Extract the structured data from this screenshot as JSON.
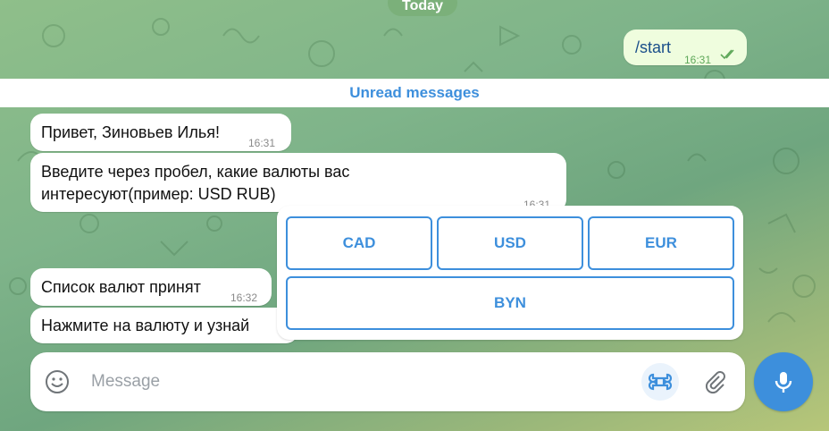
{
  "date_separator": "Today",
  "unread_label": "Unread messages",
  "outgoing": [
    {
      "text": "/start",
      "time": "16:31"
    }
  ],
  "incoming": [
    {
      "text": "Привет, Зиновьев Илья!",
      "time": "16:31"
    },
    {
      "line1": "Введите через пробел, какие валюты вас",
      "line2": "интересуют(пример: USD RUB)",
      "time": "16:31"
    },
    {
      "text": "Список валют принят",
      "time": "16:32"
    },
    {
      "text": "Нажмите на валюту и узнай"
    }
  ],
  "keyboard": {
    "row1": [
      "CAD",
      "USD",
      "EUR"
    ],
    "row2": [
      "BYN"
    ]
  },
  "composer": {
    "placeholder": "Message"
  },
  "colors": {
    "accent": "#3d8fdc",
    "outgoing_bubble": "#effdde",
    "read_check": "#5fa85a"
  },
  "icons": [
    "emoji-icon",
    "bot-command-icon",
    "attach-icon",
    "microphone-icon",
    "double-check-icon"
  ]
}
